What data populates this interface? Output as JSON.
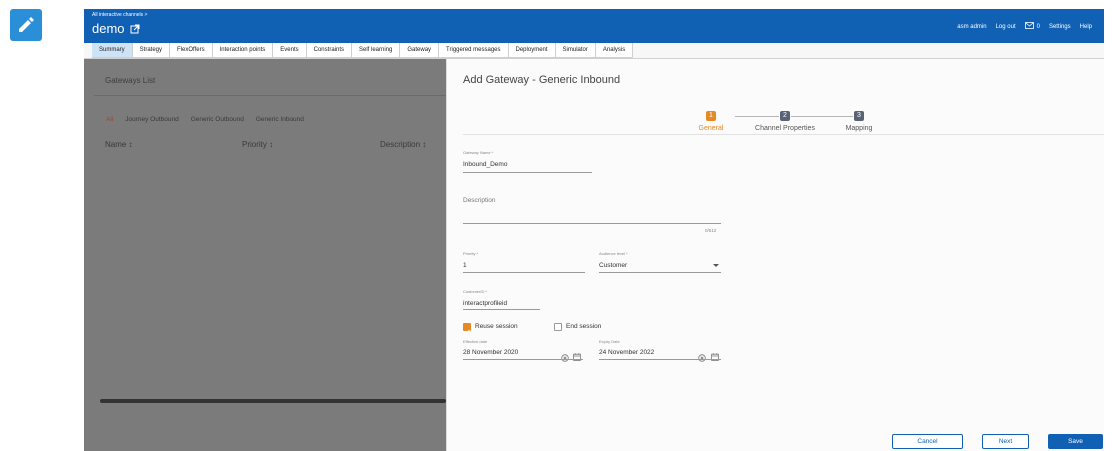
{
  "header": {
    "breadcrumb": "All interactive channels >",
    "title": "demo",
    "user": "asm admin",
    "logout": "Log out",
    "mail_count": "0",
    "settings": "Settings",
    "help": "Help"
  },
  "tabs": [
    {
      "label": "Summary",
      "active": true
    },
    {
      "label": "Strategy"
    },
    {
      "label": "FlexOffers"
    },
    {
      "label": "Interaction points"
    },
    {
      "label": "Events"
    },
    {
      "label": "Constraints"
    },
    {
      "label": "Self learning"
    },
    {
      "label": "Gateway"
    },
    {
      "label": "Triggered messages"
    },
    {
      "label": "Deployment"
    },
    {
      "label": "Simulator"
    },
    {
      "label": "Analysis"
    }
  ],
  "gateway_list": {
    "title": "Gateways List",
    "filters": [
      "All",
      "Journey Outbound",
      "Generic Outbound",
      "Generic Inbound"
    ],
    "columns": [
      "Name ↕",
      "Priority ↕",
      "Description ↕"
    ]
  },
  "panel": {
    "title": "Add Gateway - Generic Inbound",
    "steps": [
      {
        "num": "1",
        "label": "General",
        "active": true
      },
      {
        "num": "2",
        "label": "Channel Properties"
      },
      {
        "num": "3",
        "label": "Mapping"
      }
    ],
    "gateway_name_label": "Gateway Name *",
    "gateway_name_value": "Inbound_Demo",
    "description_label": "Description",
    "description_counter": "0/512",
    "priority_label": "Priority *",
    "priority_value": "1",
    "audience_label": "Audience level *",
    "audience_value": "Customer",
    "customer_id_label": "CustomerID *",
    "customer_id_value": "interactprofileid",
    "reuse_session": "Reuse session",
    "reuse_session_checked": true,
    "end_session": "End session",
    "end_session_checked": false,
    "effective_label": "Effective date",
    "effective_value": "28 November 2020",
    "expiry_label": "Expiry Date",
    "expiry_value": "24 November 2022",
    "cancel": "Cancel",
    "next": "Next",
    "save": "Save"
  },
  "colors": {
    "header_bg": "#1060b4",
    "accent_orange": "#e58a24",
    "step_inactive": "#5a6275",
    "overlay": "#7b7b7b"
  }
}
